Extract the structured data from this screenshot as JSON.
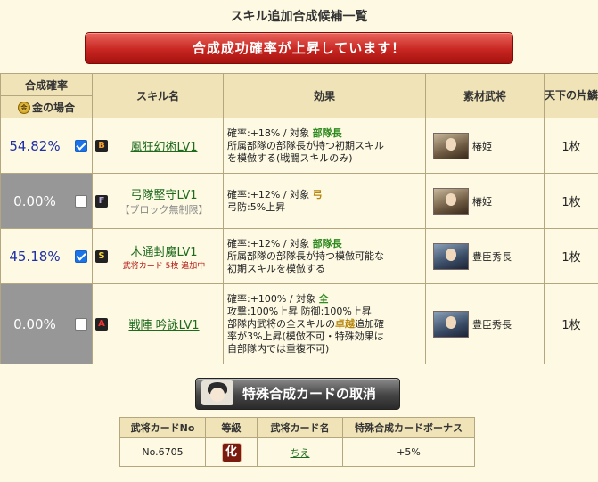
{
  "page_title": "スキル追加合成候補一覧",
  "banner_text": "合成成功確率が上昇しています！",
  "table": {
    "headers": {
      "rate": "合成確率",
      "gold_case": "金の場合",
      "skill": "スキル名",
      "effect": "効果",
      "material": "素材武将",
      "tenka": "天下の片鱗"
    },
    "rows": [
      {
        "rate": "54.82%",
        "checked": true,
        "rank": "B",
        "skill_name": "風狂幻術LV1",
        "sub": "",
        "effect_line1_prefix": "確率:+18%  /  対象 ",
        "effect_target": "部隊長",
        "effect_line2": "所属部隊の部隊長が持つ初期スキル",
        "effect_line3": "を模倣する(戦闘スキルのみ)",
        "material": "椿姫",
        "count": "1枚"
      },
      {
        "rate": "0.00%",
        "checked": false,
        "rank": "F",
        "skill_name": "弓隊堅守LV1",
        "sub": "【ブロック無制限】",
        "effect_line1_prefix": "確率:+12%  /  対象 ",
        "effect_target": "弓",
        "effect_line2": "弓防:5%上昇",
        "material": "椿姫",
        "count": "1枚"
      },
      {
        "rate": "45.18%",
        "checked": true,
        "rank": "S",
        "skill_name": "木通封魔LV1",
        "sub": "武将カード 5枚 追加中",
        "effect_line1_prefix": "確率:+12%  /  対象 ",
        "effect_target": "部隊長",
        "effect_line2": "所属部隊の部隊長が持つ模倣可能な",
        "effect_line3": "初期スキルを模倣する",
        "material": "豊臣秀長",
        "count": "1枚"
      },
      {
        "rate": "0.00%",
        "checked": false,
        "rank": "A",
        "skill_name": "戦陣 吟詠LV1",
        "sub": "",
        "effect_line1_prefix": "確率:+100%  /  対象 ",
        "effect_target": "全",
        "effect_line2": "攻撃:100%上昇  防御:100%上昇",
        "effect_line3a": "部隊内武将の全スキルの",
        "effect_line3_highlight": "卓越",
        "effect_line3b": "追加確",
        "effect_line4": "率が3%上昇(模倣不可・特殊効果は",
        "effect_line5": "自部隊内では重複不可)",
        "material": "豊臣秀長",
        "count": "1枚"
      }
    ]
  },
  "cancel_button_label": "特殊合成カードの取消",
  "card_table": {
    "headers": [
      "武将カードNo",
      "等級",
      "武将カード名",
      "特殊合成カードボーナス"
    ],
    "row": {
      "no": "No.6705",
      "grade": "化",
      "name": "ちえ",
      "bonus": "+5%"
    }
  }
}
